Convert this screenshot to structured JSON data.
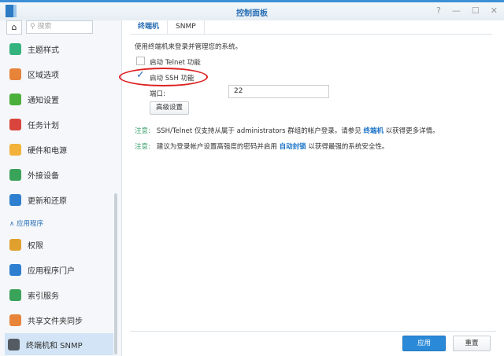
{
  "window": {
    "title": "控制面板",
    "controls": [
      "?",
      "—",
      "☐",
      "✕"
    ]
  },
  "sidebar": {
    "search_placeholder": "搜索",
    "items": [
      {
        "label": "主题样式",
        "color": "#35b37e"
      },
      {
        "label": "区域选项",
        "color": "#e8833a"
      },
      {
        "label": "通知设置",
        "color": "#4cae3b"
      },
      {
        "label": "任务计划",
        "color": "#d9453c"
      },
      {
        "label": "硬件和电源",
        "color": "#f3b23a"
      },
      {
        "label": "外接设备",
        "color": "#3aa35a"
      },
      {
        "label": "更新和还原",
        "color": "#2f7fd0"
      }
    ],
    "section": "应用程序",
    "items2": [
      {
        "label": "权限",
        "color": "#e0a02e"
      },
      {
        "label": "应用程序门户",
        "color": "#2f7fd0"
      },
      {
        "label": "索引服务",
        "color": "#3aa35a"
      },
      {
        "label": "共享文件夹同步",
        "color": "#e8833a"
      },
      {
        "label": "终端机和 SNMP",
        "color": "#555b63"
      }
    ]
  },
  "tabs": [
    "终端机",
    "SNMP"
  ],
  "content": {
    "intro": "使用终端机来登录并管理您的系统。",
    "telnet": "启动 Telnet 功能",
    "ssh": "启动 SSH 功能",
    "port_label": "端口:",
    "port_value": "22",
    "advanced": "高级设置",
    "note_label": "注意:",
    "note1_a": "SSH/Telnet 仅支持从属于 administrators 群组的帐户登录。请参见",
    "note1_link": "终端机",
    "note1_b": "以获得更多详情。",
    "note2_a": "建议为登录帐户设置高强度的密码并启用",
    "note2_link": "自动封锁",
    "note2_b": "以获得最强的系统安全性。"
  },
  "footer": {
    "apply": "应用",
    "reset": "重置"
  }
}
